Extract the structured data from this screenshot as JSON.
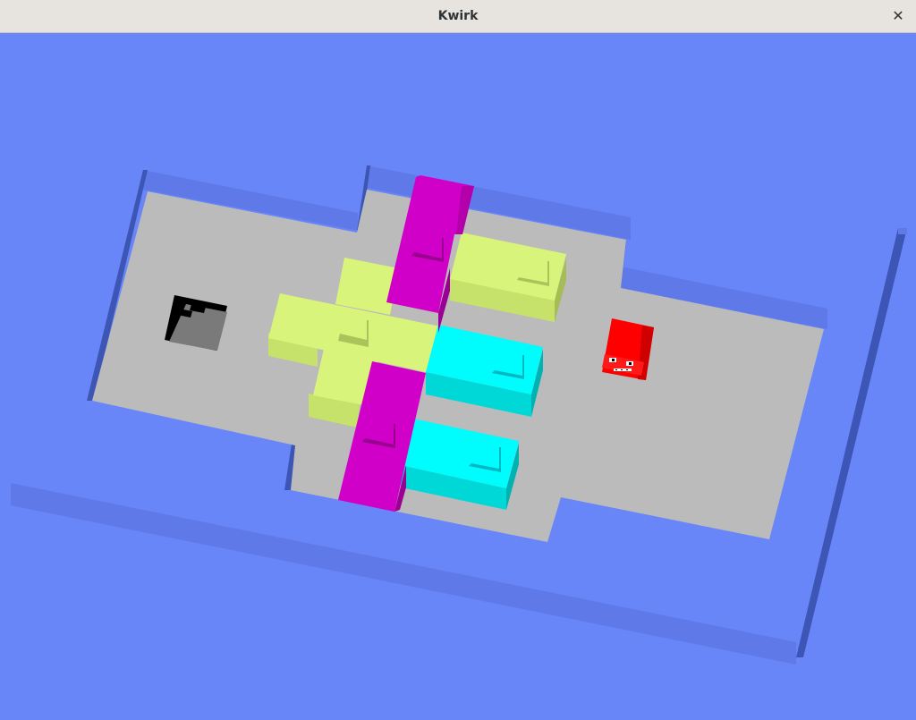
{
  "window": {
    "title": "Kwirk",
    "close_glyph": "✕"
  },
  "colors": {
    "background": "#6886f8",
    "floor": "#bbbbbb",
    "wall_top": "#5f7ae8",
    "wall_side": "#3d55b5",
    "block_yellow": "#d8f47a",
    "block_cyan": "#00fdfd",
    "block_magenta": "#d000c8",
    "player": "#ff0000",
    "stairs": "#7a7a7a"
  },
  "icons": {
    "close": "close-icon",
    "player": "kwirk-player-icon",
    "exit": "stairs-exit-icon"
  }
}
